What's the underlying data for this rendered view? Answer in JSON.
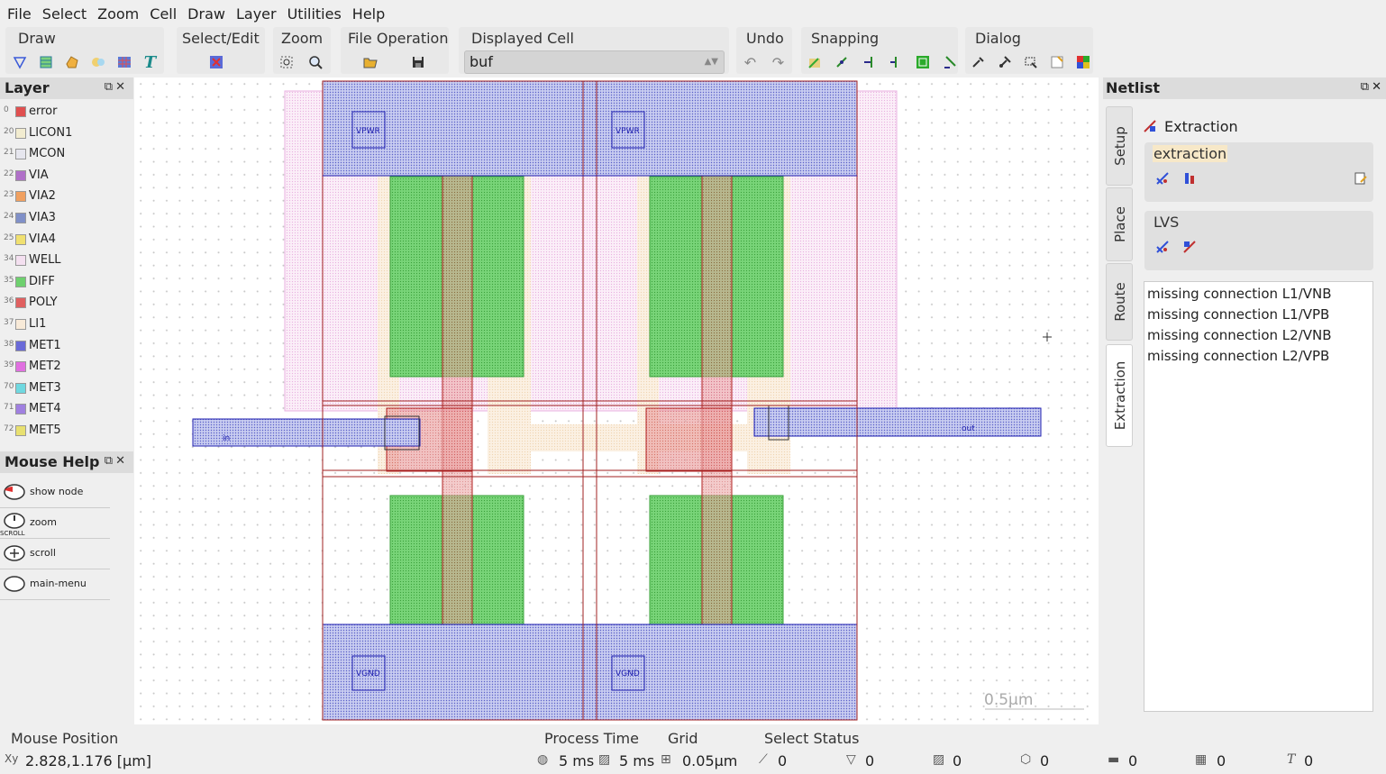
{
  "menubar": [
    "File",
    "Select",
    "Zoom",
    "Cell",
    "Draw",
    "Layer",
    "Utilities",
    "Help"
  ],
  "toolbar": {
    "draw": "Draw",
    "select_edit": "Select/Edit",
    "zoom": "Zoom",
    "file_operation": "File Operation",
    "displayed_cell": "Displayed Cell",
    "cell_value": "buf",
    "undo": "Undo",
    "snapping": "Snapping",
    "dialog": "Dialog"
  },
  "layer_panel": {
    "title": "Layer",
    "layers": [
      {
        "num": "0",
        "name": "error",
        "color": "#e05050"
      },
      {
        "num": "20",
        "name": "LICON1",
        "color": "#f2ecd0"
      },
      {
        "num": "21",
        "name": "MCON",
        "color": "#e6e6ee"
      },
      {
        "num": "22",
        "name": "VIA",
        "color": "#b070c8"
      },
      {
        "num": "23",
        "name": "VIA2",
        "color": "#f0a060"
      },
      {
        "num": "24",
        "name": "VIA3",
        "color": "#8090c8"
      },
      {
        "num": "25",
        "name": "VIA4",
        "color": "#f0e070"
      },
      {
        "num": "34",
        "name": "WELL",
        "color": "#f4e0f0"
      },
      {
        "num": "35",
        "name": "DIFF",
        "color": "#6ed06e"
      },
      {
        "num": "36",
        "name": "POLY",
        "color": "#e06060"
      },
      {
        "num": "37",
        "name": "LI1",
        "color": "#f8ead8"
      },
      {
        "num": "38",
        "name": "MET1",
        "color": "#6a6ad8"
      },
      {
        "num": "39",
        "name": "MET2",
        "color": "#e070e0"
      },
      {
        "num": "70",
        "name": "MET3",
        "color": "#70d8e0"
      },
      {
        "num": "71",
        "name": "MET4",
        "color": "#a080e0"
      },
      {
        "num": "72",
        "name": "MET5",
        "color": "#e8e070"
      }
    ]
  },
  "mouse_help": {
    "title": "Mouse Help",
    "items": [
      "show node",
      "zoom",
      "scroll",
      "main-menu"
    ],
    "scroll_caption": "SCROLL"
  },
  "canvas": {
    "labels": {
      "vpwr1": "VPWR",
      "vpwr2": "VPWR",
      "vgnd1": "VGND",
      "vgnd2": "VGND",
      "in": "in",
      "out": "out"
    },
    "scale": "0.5µm"
  },
  "netlist": {
    "title": "Netlist",
    "tabs": [
      "Setup",
      "Place",
      "Route",
      "Extraction"
    ],
    "panel_title": "Extraction",
    "section1": "extraction",
    "section2": "LVS",
    "messages": [
      "missing connection L1/VNB",
      "missing connection L1/VPB",
      "missing connection L2/VNB",
      "missing connection L2/VPB"
    ]
  },
  "status": {
    "mouse_position_label": "Mouse Position",
    "mouse_position": "2.828,1.176 [µm]",
    "process_time_label": "Process Time",
    "time1": "5 ms",
    "time2": "5 ms",
    "grid_label": "Grid",
    "grid": "0.05µm",
    "select_status_label": "Select Status",
    "counts": [
      "0",
      "0",
      "0",
      "0",
      "0",
      "0",
      "0"
    ]
  }
}
